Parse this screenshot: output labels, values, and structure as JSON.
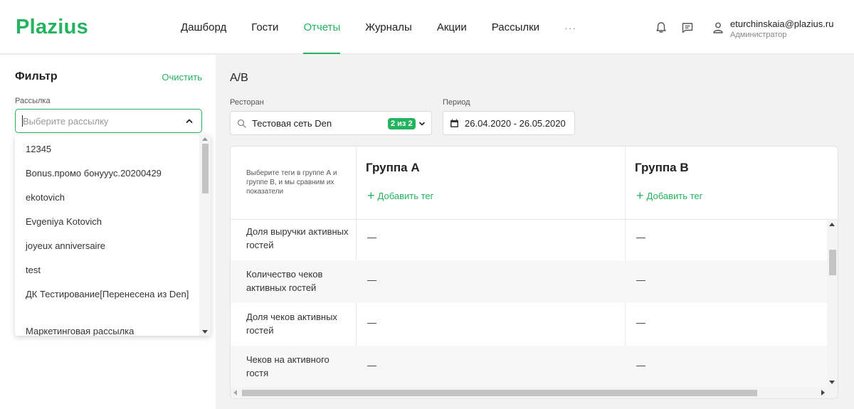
{
  "header": {
    "logo": "Plazius",
    "nav": [
      {
        "label": "Дашборд",
        "active": false
      },
      {
        "label": "Гости",
        "active": false
      },
      {
        "label": "Отчеты",
        "active": true
      },
      {
        "label": "Журналы",
        "active": false
      },
      {
        "label": "Акции",
        "active": false
      },
      {
        "label": "Рассылки",
        "active": false
      }
    ],
    "more": "···",
    "icons": [
      "bell-icon",
      "message-icon",
      "user-icon"
    ],
    "user_email": "eturchinskaia@plazius.ru",
    "user_role": "Администратор",
    "accent": "#24b35f"
  },
  "sidebar": {
    "title": "Фильтр",
    "clear": "Очистить",
    "field_label": "Рассылка",
    "placeholder": "Выберите рассылку",
    "options": [
      "12345",
      "Bonus.промо бонууус.20200429",
      "ekotovich",
      "Evgeniya Kotovich",
      "joyeux anniversaire",
      "test",
      "ДК Тестирование[Перенесена из Den]",
      "Маркетинговая рассылка"
    ]
  },
  "main": {
    "title": "A/B",
    "restaurant_label": "Ресторан",
    "restaurant_value": "Тестовая сеть Den",
    "restaurant_badge": "2 из 2",
    "period_label": "Период",
    "period_value": "26.04.2020 - 26.05.2020",
    "hint": "Выберите теги в группе А и группе В, и мы сравним их показатели",
    "group_a": "Группа А",
    "group_b": "Группа В",
    "add_tag": "Добавить тег",
    "rows": [
      {
        "label": "Доля выручки активных гостей",
        "a": "—",
        "b": "—"
      },
      {
        "label": "Количество чеков активных гостей",
        "a": "—",
        "b": "—"
      },
      {
        "label": "Доля чеков активных гостей",
        "a": "—",
        "b": "—"
      },
      {
        "label": "Чеков на активного гостя",
        "a": "—",
        "b": "—"
      }
    ]
  }
}
